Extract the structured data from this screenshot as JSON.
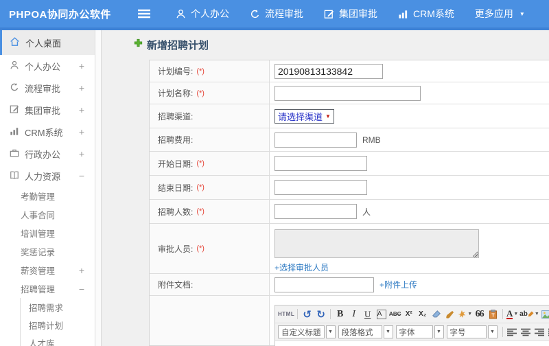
{
  "header": {
    "logo": "PHPOA协同办公软件",
    "nav": [
      {
        "label": "个人办公"
      },
      {
        "label": "流程审批"
      },
      {
        "label": "集团审批"
      },
      {
        "label": "CRM系统"
      },
      {
        "label": "更多应用"
      }
    ]
  },
  "sidebar": {
    "items": [
      {
        "label": "个人桌面"
      },
      {
        "label": "个人办公",
        "toggle": "+"
      },
      {
        "label": "流程审批",
        "toggle": "+"
      },
      {
        "label": "集团审批",
        "toggle": "+"
      },
      {
        "label": "CRM系统",
        "toggle": "+"
      },
      {
        "label": "行政办公",
        "toggle": "+"
      },
      {
        "label": "人力资源",
        "toggle": "−"
      }
    ],
    "hr_children": [
      {
        "label": "考勤管理"
      },
      {
        "label": "人事合同"
      },
      {
        "label": "培训管理"
      },
      {
        "label": "奖惩记录"
      },
      {
        "label": "薪资管理",
        "toggle": "+"
      },
      {
        "label": "招聘管理",
        "toggle": "−"
      }
    ],
    "recruit_children": [
      {
        "label": "招聘需求"
      },
      {
        "label": "招聘计划"
      },
      {
        "label": "人才库"
      }
    ]
  },
  "main": {
    "title": "新增招聘计划",
    "form": {
      "required_mark": "(*)",
      "plan_no": {
        "label": "计划编号:",
        "value": "20190813133842"
      },
      "plan_name": {
        "label": "计划名称:",
        "value": ""
      },
      "channel": {
        "label": "招聘渠道:",
        "selected": "请选择渠道"
      },
      "fee": {
        "label": "招聘费用:",
        "value": "",
        "unit": "RMB"
      },
      "start_date": {
        "label": "开始日期:",
        "value": ""
      },
      "end_date": {
        "label": "结束日期:",
        "value": ""
      },
      "headcount": {
        "label": "招聘人数:",
        "value": "",
        "unit": "人"
      },
      "approver": {
        "label": "审批人员:",
        "value": "",
        "link": "+选择审批人员"
      },
      "attachment": {
        "label": "附件文档:",
        "value": "",
        "link": "+附件上传"
      }
    },
    "editor": {
      "buttons": {
        "html": "HTML",
        "undo": "↺",
        "redo": "↻",
        "bold": "B",
        "italic": "I",
        "underline": "U",
        "plain_a": "A",
        "strikethrough": "ABC",
        "superscript": "X²",
        "subscript": "X₂",
        "blockquote": "66",
        "forecolor": "A",
        "hilitecolor": "ab"
      },
      "selects": {
        "heading": "自定义标题",
        "paragraph": "段落格式",
        "font": "字体",
        "size": "字号"
      }
    }
  },
  "icons": {
    "caret": "▼",
    "scissors": "✂"
  }
}
